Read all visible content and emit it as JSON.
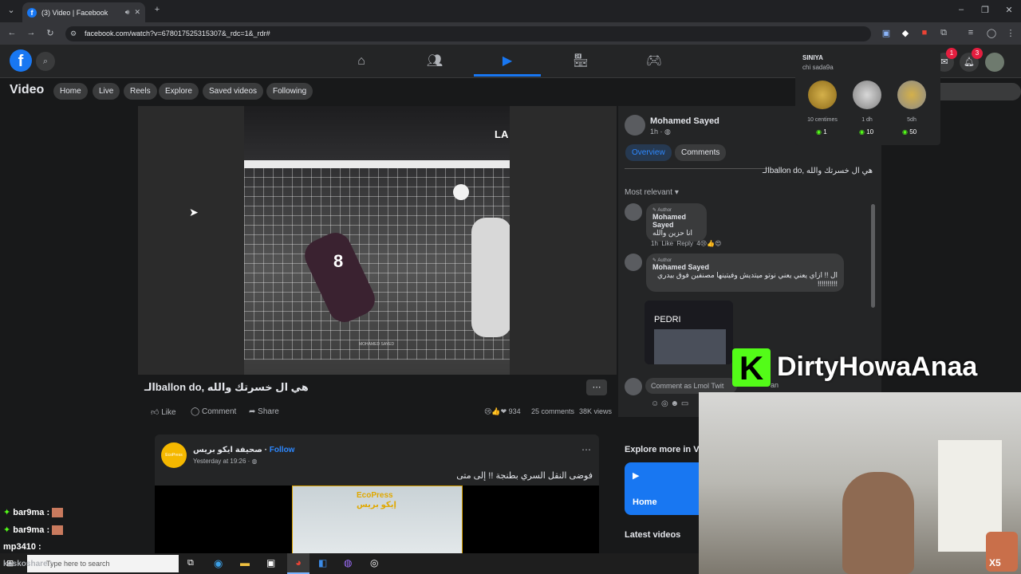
{
  "browser": {
    "tab_title": "(3) Video | Facebook",
    "url": "facebook.com/watch?v=678017525315307&_rdc=1&_rdr#"
  },
  "fb": {
    "notif_count_msg": "1",
    "notif_count_bell": "3"
  },
  "video_nav": {
    "title": "Video",
    "pills": [
      "Home",
      "Live",
      "Reels",
      "Explore",
      "Saved videos",
      "Following"
    ]
  },
  "player": {
    "corner_text": "LA",
    "jersey": "8",
    "watermark": "MOHAMED SAYED"
  },
  "post": {
    "title": "الـballon do, هي ال خسرتك والله",
    "like": "Like",
    "comment": "Comment",
    "share": "Share",
    "reactions": "934",
    "comments_count": "25 comments",
    "views": "38K views"
  },
  "right": {
    "author": "Mohamed Sayed",
    "time": "1h",
    "tab_overview": "Overview",
    "tab_comments": "Comments",
    "caption": "الـballon do, هي ال خسرتك والله",
    "sort": "Most relevant",
    "comments": [
      {
        "tag": "Author",
        "name": "Mohamed Sayed",
        "text": "انا حزين والله",
        "time": "1h",
        "like": "Like",
        "reply": "Reply",
        "reacts": "4"
      },
      {
        "tag": "Author",
        "name": "Mohamed Sayed",
        "text": "ال !! ازاي يعني يعني نوتو ميتديش وفيتينها مصنفين فوق بيدري !!!!!!!!!!"
      }
    ],
    "image_label": "PEDRI",
    "comment_placeholder": "Comment as Lmol Twit",
    "comment_tail": "an",
    "explore": "Explore more in Vi",
    "explore_home": "Home",
    "latest": "Latest videos"
  },
  "post2": {
    "page_name": "صحيفة ايكو بريس",
    "follow": "Follow",
    "time": "Yesterday at 19:26",
    "text": "فوضى النقل السري بطنجة !! إلى متى",
    "logo_top": "EcoPress",
    "logo_bottom": "إيكو بريس"
  },
  "coins": {
    "header": "SINIYA",
    "sub": "chi sada9a",
    "items": [
      {
        "label": "10 centimes",
        "value": "1"
      },
      {
        "label": "1 dh",
        "value": "10"
      },
      {
        "label": "5dh",
        "value": "50"
      }
    ]
  },
  "kick": {
    "logo": "K",
    "name": "DirtyHowaAnaa"
  },
  "chat": [
    {
      "user": "bar9ma :"
    },
    {
      "user": "bar9ma :"
    },
    {
      "user": "mp3410 :"
    },
    {
      "user": "koskoshare :"
    }
  ],
  "taskbar": {
    "search": "Type here to search"
  },
  "cam": {
    "badge": "X5"
  }
}
